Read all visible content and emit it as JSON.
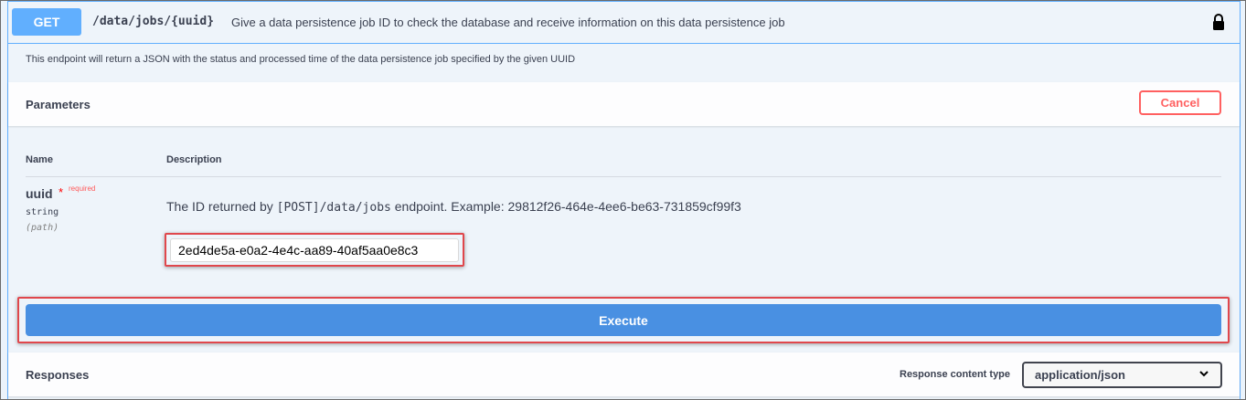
{
  "endpoint": {
    "method": "GET",
    "path": "/data/jobs/{uuid}",
    "summary": "Give a data persistence job ID to check the database and receive information on this data persistence job",
    "description": "This endpoint will return a JSON with the status and processed time of the data persistence job specified by the given UUID",
    "lock_icon": "lock-icon"
  },
  "parameters": {
    "title": "Parameters",
    "cancel_label": "Cancel",
    "col_name": "Name",
    "col_description": "Description",
    "items": [
      {
        "name": "uuid",
        "required_star": "*",
        "required_label": "required",
        "type": "string",
        "in": "(path)",
        "desc_prefix": "The ID returned by ",
        "desc_code": "[POST]/data/jobs",
        "desc_suffix": " endpoint. Example: 29812f26-464e-4ee6-be63-731859cf99f3",
        "value": "2ed4de5a-e0a2-4e4c-aa89-40af5aa0e8c3"
      }
    ]
  },
  "execute_label": "Execute",
  "responses": {
    "title": "Responses",
    "content_type_label": "Response content type",
    "content_type_value": "application/json"
  },
  "colors": {
    "get": "#61affe",
    "execute": "#4990e2",
    "cancel": "#ff6060",
    "highlight": "#e0474c"
  }
}
